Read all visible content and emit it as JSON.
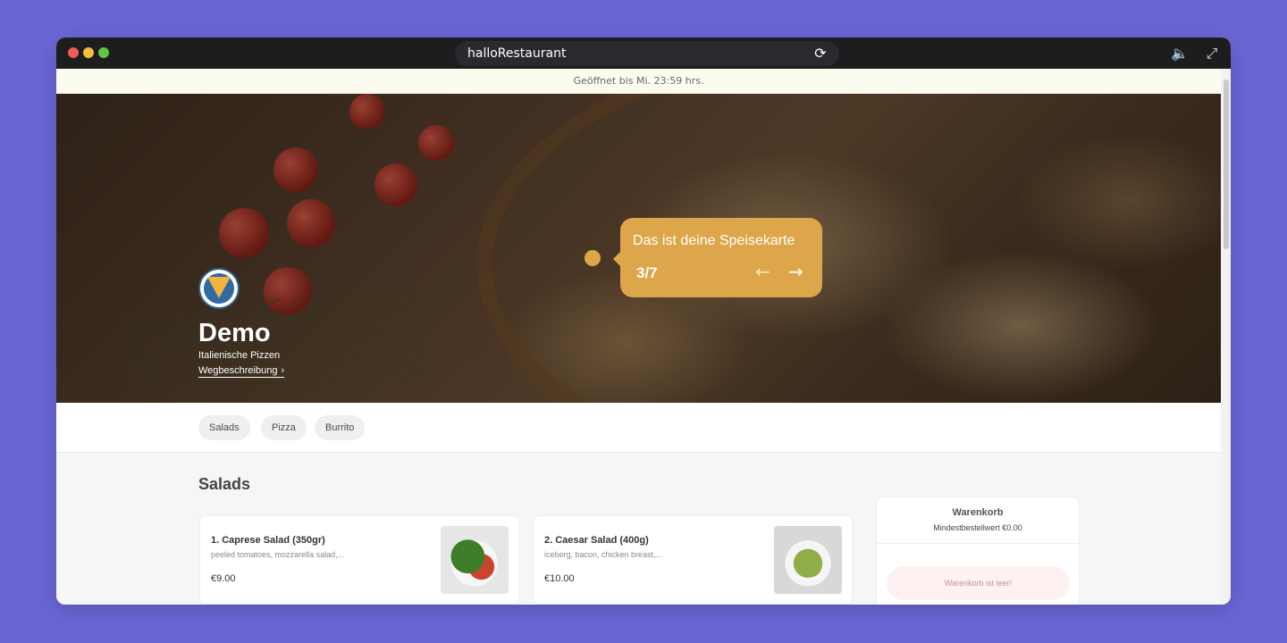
{
  "browser": {
    "url_text": "halloRestaurant",
    "icons": [
      "reload-icon",
      "speaker-icon",
      "expand-icon"
    ]
  },
  "banner": {
    "opening_text": "Geöffnet bis Mi. 23:59 hrs."
  },
  "hero": {
    "restaurant_name": "Demo",
    "subtitle": "Italienische Pizzen",
    "directions_link": "Wegbeschreibung",
    "directions_chevron": "›"
  },
  "tour": {
    "title": "Das ist deine Speisekarte",
    "step": "3/7",
    "prev_arrow": "←",
    "next_arrow": "→",
    "accent_color": "#dea64a"
  },
  "categories": [
    "Salads",
    "Pizza",
    "Burrito"
  ],
  "menu": {
    "section_title": "Salads",
    "items": [
      {
        "title": "1. Caprese Salad (350gr)",
        "description": "peeled tomatoes, mozzarella salad,...",
        "price": "€9.00",
        "image": "caprese-salad-photo"
      },
      {
        "title": "2. Caesar Salad (400g)",
        "description": "iceberg, bacon, chicken breast,...",
        "price": "€10.00",
        "image": "caesar-salad-photo"
      }
    ]
  },
  "cart": {
    "title": "Warenkorb",
    "minimum": "Mindestbestellwert €0.00",
    "empty_text": "Warenkorb ist leer!"
  }
}
